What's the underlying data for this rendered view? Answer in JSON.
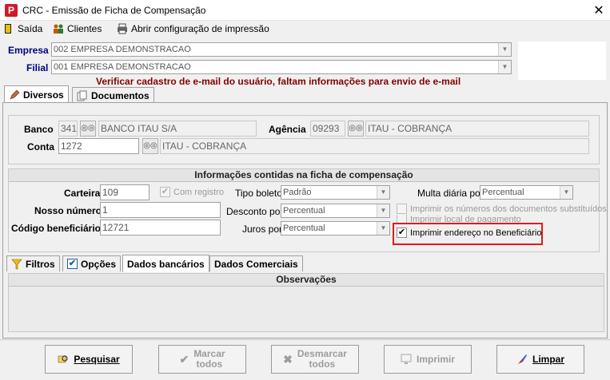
{
  "window": {
    "title": "CRC - Emissão de Ficha de Compensação",
    "icon_letter": "P"
  },
  "menu": {
    "saida": "Saída",
    "clientes": "Clientes",
    "config": "Abrir configuração de impressão"
  },
  "empresa": {
    "label": "Empresa",
    "value": "002 EMPRESA DEMONSTRACAO"
  },
  "filial": {
    "label": "Filial",
    "value": "001 EMPRESA DEMONSTRACAO"
  },
  "warning": "Verificar cadastro de e-mail do usuário, faltam informações para envio de e-mail",
  "top_tabs": {
    "diversos": "Diversos",
    "documentos": "Documentos"
  },
  "banco": {
    "label": "Banco",
    "code": "341",
    "name": "BANCO ITAU S/A"
  },
  "agencia": {
    "label": "Agência",
    "code": "09293",
    "name": "ITAU - COBRANÇA"
  },
  "conta": {
    "label": "Conta",
    "code": "1272",
    "name": "ITAU - COBRANÇA"
  },
  "info_header": "Informações contidas na ficha de compensação",
  "carteira": {
    "label": "Carteira",
    "value": "109",
    "com_registro": "Com registro"
  },
  "nosso_numero": {
    "label": "Nosso número",
    "value": "1"
  },
  "codigo_beneficiario": {
    "label": "Código beneficiário",
    "value": "12721"
  },
  "tipo_boleto": {
    "label": "Tipo boleto",
    "value": "Padrão"
  },
  "desconto_por": {
    "label": "Desconto por",
    "value": "Percentual"
  },
  "juros_por": {
    "label": "Juros por",
    "value": "Percentual"
  },
  "multa_diaria": {
    "label": "Multa diária por",
    "value": "Percentual"
  },
  "checks": {
    "imprimir_numeros": "Imprimir os números dos documentos substituídos",
    "imprimir_local": "Imprimir local de pagamento",
    "imprimir_endereco": "Imprimir endereço no Beneficiário"
  },
  "bottom_tabs": {
    "filtros": "Filtros",
    "opcoes": "Opções",
    "dados_bancarios": "Dados bancários",
    "dados_comerciais": "Dados Comerciais"
  },
  "observacoes": "Observações",
  "buttons": {
    "pesquisar": "Pesquisar",
    "marcar_1": "Marcar",
    "marcar_2": "todos",
    "desmarcar_1": "Desmarcar",
    "desmarcar_2": "todos",
    "imprimir": "Imprimir",
    "limpar": "Limpar"
  },
  "colors": {
    "highlight_border": "#e01b1b",
    "label_blue": "#000080",
    "warning": "#800000"
  }
}
